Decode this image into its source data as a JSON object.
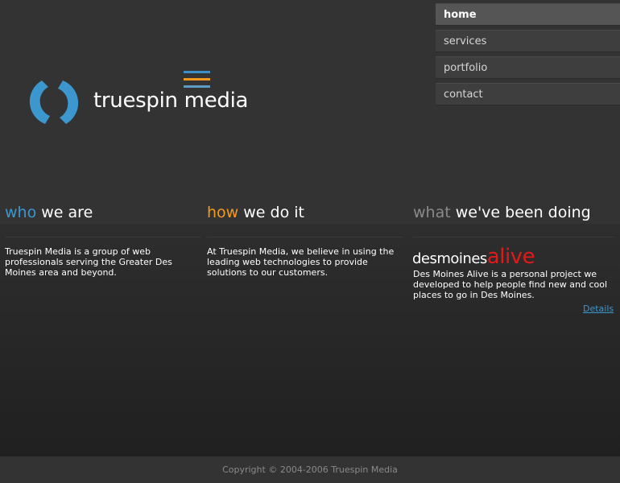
{
  "brand": {
    "name": "truespin media"
  },
  "nav": {
    "items": [
      {
        "label": "home",
        "active": true
      },
      {
        "label": "services",
        "active": false
      },
      {
        "label": "portfolio",
        "active": false
      },
      {
        "label": "contact",
        "active": false
      }
    ]
  },
  "sections": {
    "who": {
      "accent": "who",
      "rest": " we are",
      "text": "Truespin Media is a group of web professionals serving the Greater Des Moines area and beyond."
    },
    "how": {
      "accent": "how",
      "rest": " we do it",
      "text": "At Truespin Media, we believe in using the leading web technologies to provide solutions to our customers."
    },
    "what": {
      "accent": "what",
      "rest": " we've been doing",
      "project_name_part1": "desmoines",
      "project_name_part2": "alive",
      "text": "Des Moines Alive is a personal project we developed to help people find new and cool places to go in Des Moines.",
      "details_link": "Details"
    }
  },
  "footer": {
    "copyright": "Copyright © 2004-2006 Truespin Media"
  },
  "colors": {
    "blue": "#3c97cf",
    "orange": "#f39a1d",
    "red": "#e01a1a"
  }
}
